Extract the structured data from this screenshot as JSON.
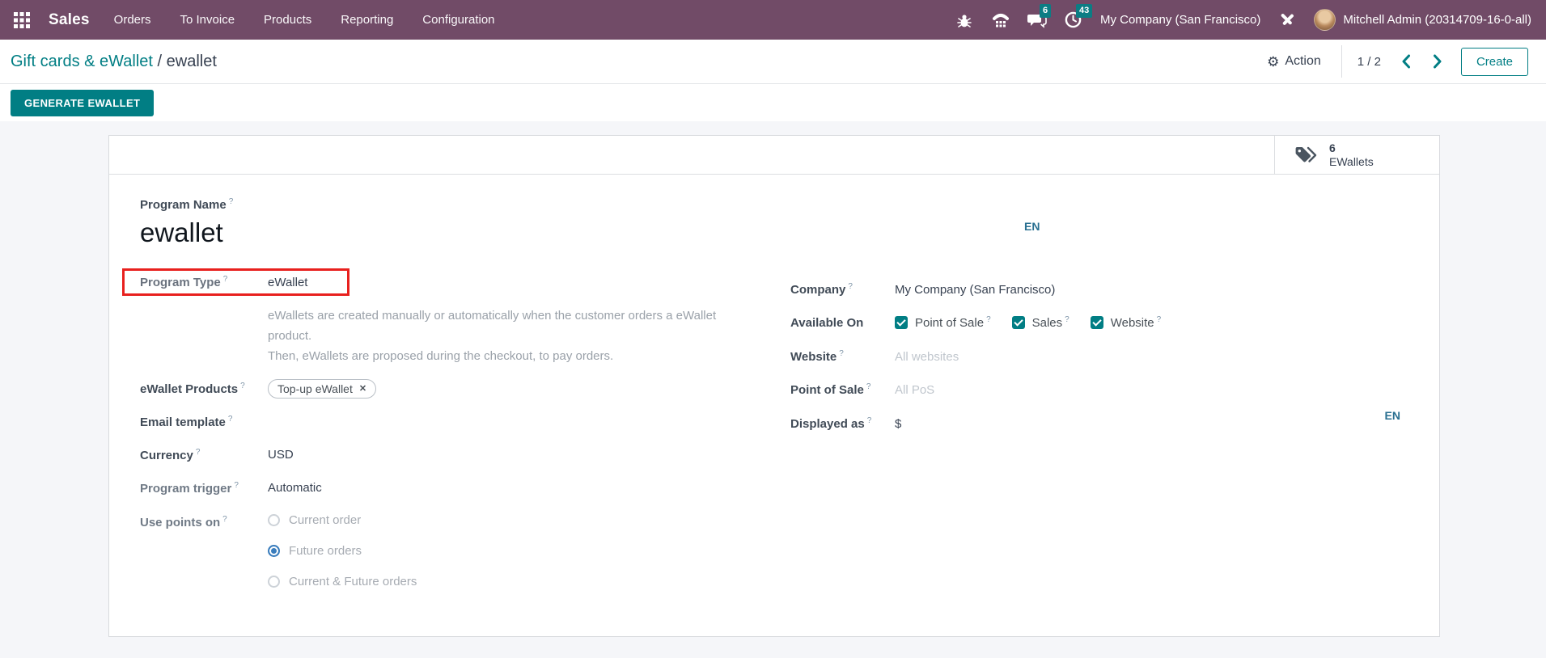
{
  "topbar": {
    "app": "Sales",
    "menus": [
      "Orders",
      "To Invoice",
      "Products",
      "Reporting",
      "Configuration"
    ],
    "message_count": "6",
    "activity_count": "43",
    "company": "My Company (San Francisco)",
    "user": "Mitchell Admin (20314709-16-0-all)"
  },
  "breadcrumb": {
    "parent": "Gift cards & eWallet",
    "separator": "/",
    "current": "ewallet"
  },
  "control_panel": {
    "action": "Action",
    "pager": "1 / 2",
    "create": "Create"
  },
  "status_bar": {
    "generate": "GENERATE EWALLET"
  },
  "stat_button": {
    "count": "6",
    "label": "EWallets"
  },
  "help_marker": "?",
  "lang_badge": "EN",
  "icons": {
    "action_gear": "⚙",
    "tag_remove": "✕"
  },
  "form_left": {
    "program_name": {
      "label": "Program Name",
      "value": "ewallet"
    },
    "program_type": {
      "label": "Program Type",
      "value": "eWallet"
    },
    "type_help": [
      "eWallets are created manually or automatically when the customer orders a eWallet product.",
      "Then, eWallets are proposed during the checkout, to pay orders."
    ],
    "products": {
      "label": "eWallet Products",
      "tag": "Top-up eWallet"
    },
    "email_template": {
      "label": "Email template",
      "value": ""
    },
    "currency": {
      "label": "Currency",
      "value": "USD"
    },
    "trigger": {
      "label": "Program trigger",
      "value": "Automatic"
    },
    "use_points": {
      "label": "Use points on",
      "options": [
        {
          "label": "Current order",
          "checked": false
        },
        {
          "label": "Future orders",
          "checked": true
        },
        {
          "label": "Current & Future orders",
          "checked": false
        }
      ]
    }
  },
  "form_right": {
    "company": {
      "label": "Company",
      "value": "My Company (San Francisco)"
    },
    "available_on": {
      "label": "Available On",
      "options": [
        "Point of Sale",
        "Sales",
        "Website"
      ]
    },
    "website": {
      "label": "Website",
      "placeholder": "All websites"
    },
    "pos": {
      "label": "Point of Sale",
      "placeholder": "All PoS"
    },
    "displayed_as": {
      "label": "Displayed as",
      "value": "$"
    }
  },
  "colors": {
    "navbar": "#714b67",
    "accent_teal": "#017e84",
    "badge_teal": "#0b7d84",
    "highlight_red": "#e8201e",
    "radio_blue": "#3a7dbd"
  }
}
